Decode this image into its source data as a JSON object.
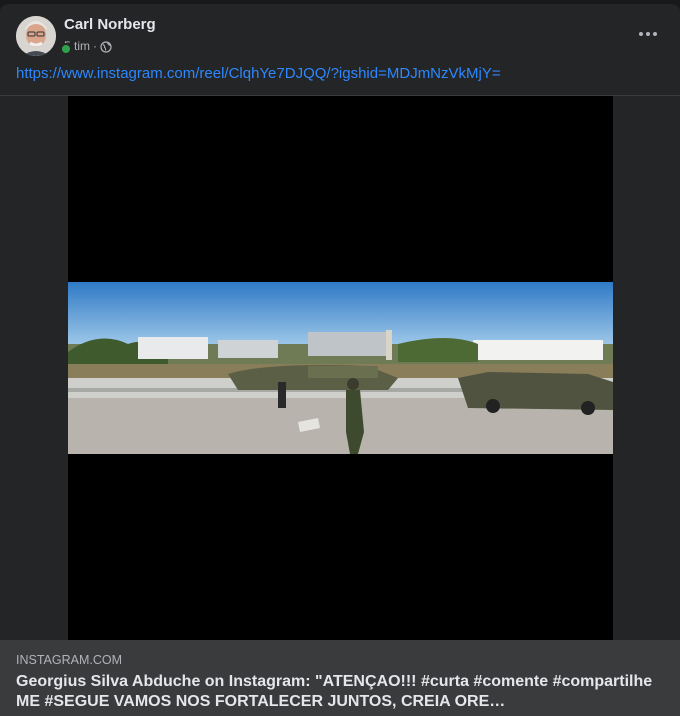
{
  "post": {
    "author": "Carl Norberg",
    "time": "5 tim",
    "separator": "·",
    "privacy_icon": "globe-icon",
    "link": "https://www.instagram.com/reel/ClqhYe7DJQQ/?igshid=MDJmNzVkMjY="
  },
  "preview": {
    "domain": "INSTAGRAM.COM",
    "title": "Georgius Silva Abduche on Instagram: \"ATENÇAO!!! #curta #comente #compartilhe ME #SEGUE VAMOS NOS FORTALECER JUNTOS, CREIA ORE…"
  },
  "colors": {
    "card_bg": "#242526",
    "page_bg": "#18191a",
    "link": "#2d88ff",
    "online": "#31a24c",
    "preview_bg": "#3a3b3c"
  }
}
